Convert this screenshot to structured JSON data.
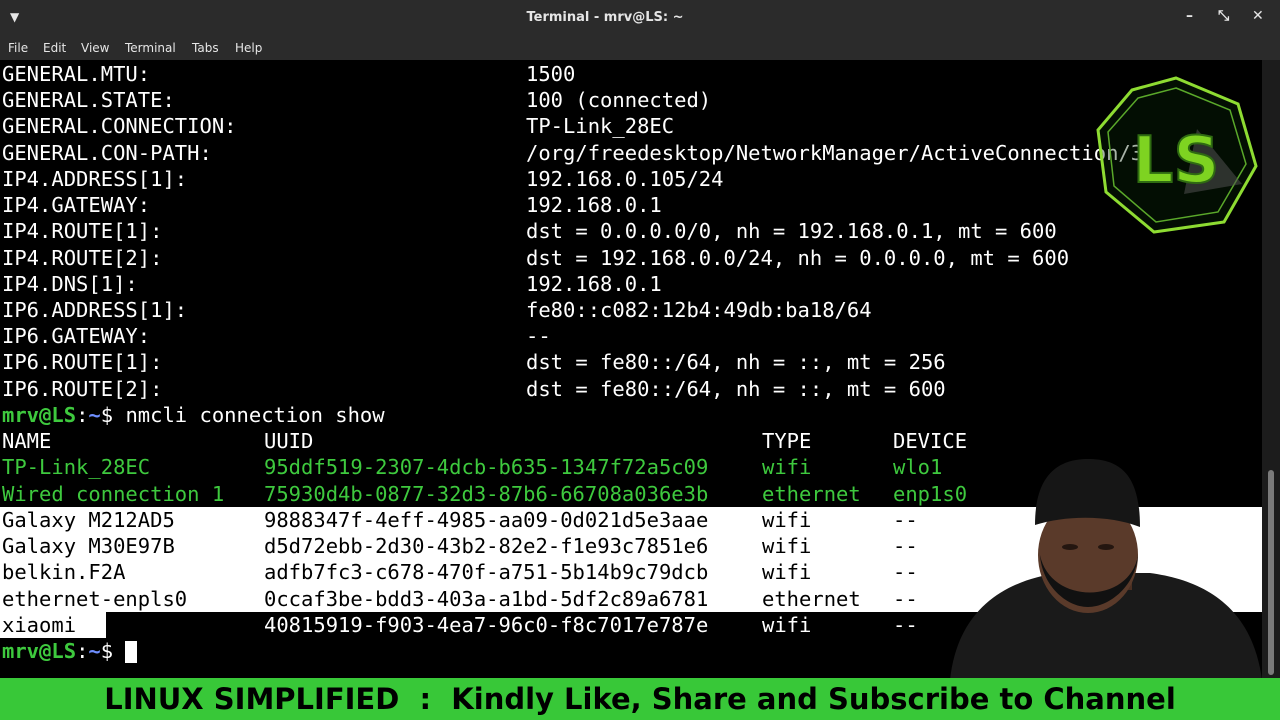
{
  "window": {
    "title": "Terminal - mrv@LS: ~",
    "menu": [
      "File",
      "Edit",
      "View",
      "Terminal",
      "Tabs",
      "Help"
    ]
  },
  "details": [
    {
      "key": "GENERAL.MTU:",
      "value": "1500"
    },
    {
      "key": "GENERAL.STATE:",
      "value": "100 (connected)"
    },
    {
      "key": "GENERAL.CONNECTION:",
      "value": "TP-Link_28EC"
    },
    {
      "key": "GENERAL.CON-PATH:",
      "value": "/org/freedesktop/NetworkManager/ActiveConnection/3"
    },
    {
      "key": "IP4.ADDRESS[1]:",
      "value": "192.168.0.105/24"
    },
    {
      "key": "IP4.GATEWAY:",
      "value": "192.168.0.1"
    },
    {
      "key": "IP4.ROUTE[1]:",
      "value": "dst = 0.0.0.0/0, nh = 192.168.0.1, mt = 600"
    },
    {
      "key": "IP4.ROUTE[2]:",
      "value": "dst = 192.168.0.0/24, nh = 0.0.0.0, mt = 600"
    },
    {
      "key": "IP4.DNS[1]:",
      "value": "192.168.0.1"
    },
    {
      "key": "IP6.ADDRESS[1]:",
      "value": "fe80::c082:12b4:49db:ba18/64"
    },
    {
      "key": "IP6.GATEWAY:",
      "value": "--"
    },
    {
      "key": "IP6.ROUTE[1]:",
      "value": "dst = fe80::/64, nh = ::, mt = 256"
    },
    {
      "key": "IP6.ROUTE[2]:",
      "value": "dst = fe80::/64, nh = ::, mt = 600"
    }
  ],
  "prompt": {
    "user_host": "mrv@LS",
    "sep": ":",
    "path": "~",
    "symbol": "$"
  },
  "command": "nmcli connection show",
  "table": {
    "headers": [
      "NAME",
      "UUID",
      "TYPE",
      "DEVICE"
    ],
    "rows": [
      [
        "TP-Link_28EC",
        "95ddf519-2307-4dcb-b635-1347f72a5c09",
        "wifi",
        "wlo1"
      ],
      [
        "Wired connection 1",
        "75930d4b-0877-32d3-87b6-66708a036e3b",
        "ethernet",
        "enp1s0"
      ],
      [
        "Galaxy M212AD5",
        "9888347f-4eff-4985-aa09-0d021d5e3aae",
        "wifi",
        "--"
      ],
      [
        "Galaxy M30E97B",
        "d5d72ebb-2d30-43b2-82e2-f1e93c7851e6",
        "wifi",
        "--"
      ],
      [
        "belkin.F2A",
        "adfb7fc3-c678-470f-a751-5b14b9c79dcb",
        "wifi",
        "--"
      ],
      [
        "ethernet-enpls0",
        "0ccaf3be-bdd3-403a-a1bd-5df2c89a6781",
        "ethernet",
        "--"
      ],
      [
        "xiaomi",
        "40815919-f903-4ea7-96c0-f8c7017e787e",
        "wifi",
        "--"
      ]
    ]
  },
  "logo": {
    "text": "LS"
  },
  "banner": {
    "text": "LINUX SIMPLIFIED  :  Kindly Like, Share and Subscribe to Channel"
  },
  "colors": {
    "green": "#3ec93e",
    "prompt_blue": "#6f8fff",
    "banner_green": "#38c838"
  }
}
